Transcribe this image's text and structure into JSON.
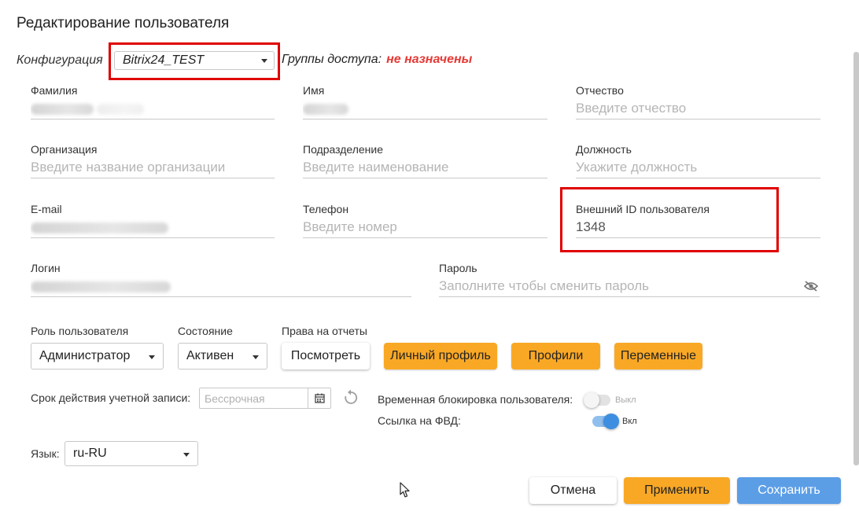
{
  "dialog": {
    "title": "Редактирование пользователя"
  },
  "config": {
    "label": "Конфигурация",
    "value": "Bitrix24_TEST",
    "groups_label": "Группы доступа:",
    "groups_value": "не назначены"
  },
  "fields": {
    "last_name": {
      "label": "Фамилия",
      "value": ""
    },
    "first_name": {
      "label": "Имя",
      "value": ""
    },
    "patronymic": {
      "label": "Отчество",
      "placeholder": "Введите отчество"
    },
    "organization": {
      "label": "Организация",
      "placeholder": "Введите название организации"
    },
    "department": {
      "label": "Подразделение",
      "placeholder": "Введите наименование"
    },
    "position": {
      "label": "Должность",
      "placeholder": "Укажите должность"
    },
    "email": {
      "label": "E-mail",
      "value": ""
    },
    "phone": {
      "label": "Телефон",
      "placeholder": "Введите номер"
    },
    "external_id": {
      "label": "Внешний ID пользователя",
      "value": "1348"
    },
    "login": {
      "label": "Логин",
      "value": ""
    },
    "password": {
      "label": "Пароль",
      "placeholder": "Заполните чтобы сменить пароль"
    }
  },
  "role": {
    "label": "Роль пользователя",
    "value": "Администратор"
  },
  "state": {
    "label": "Состояние",
    "value": "Активен"
  },
  "reports": {
    "label": "Права на отчеты",
    "button": "Посмотреть"
  },
  "buttons": {
    "personal_profile": "Личный профиль",
    "profiles": "Профили",
    "variables": "Переменные",
    "cancel": "Отмена",
    "apply": "Применить",
    "save": "Сохранить"
  },
  "expiry": {
    "label": "Срок действия учетной записи:",
    "placeholder": "Бессрочная"
  },
  "temp_block": {
    "label": "Временная блокировка пользователя:",
    "state": "Выкл",
    "on": false
  },
  "fvd_link": {
    "label": "Ссылка на ФВД:",
    "state": "Вкл",
    "on": true
  },
  "language": {
    "label": "Язык:",
    "value": "ru-RU"
  },
  "colors": {
    "accent_orange": "#f9a825",
    "primary_blue": "#5c9ee6",
    "warning_red": "#e53935",
    "highlight_box": "#e00000"
  },
  "icons": [
    "chevron-down-icon",
    "eye-off-icon",
    "calendar-icon",
    "reset-icon",
    "mouse-cursor-icon"
  ]
}
